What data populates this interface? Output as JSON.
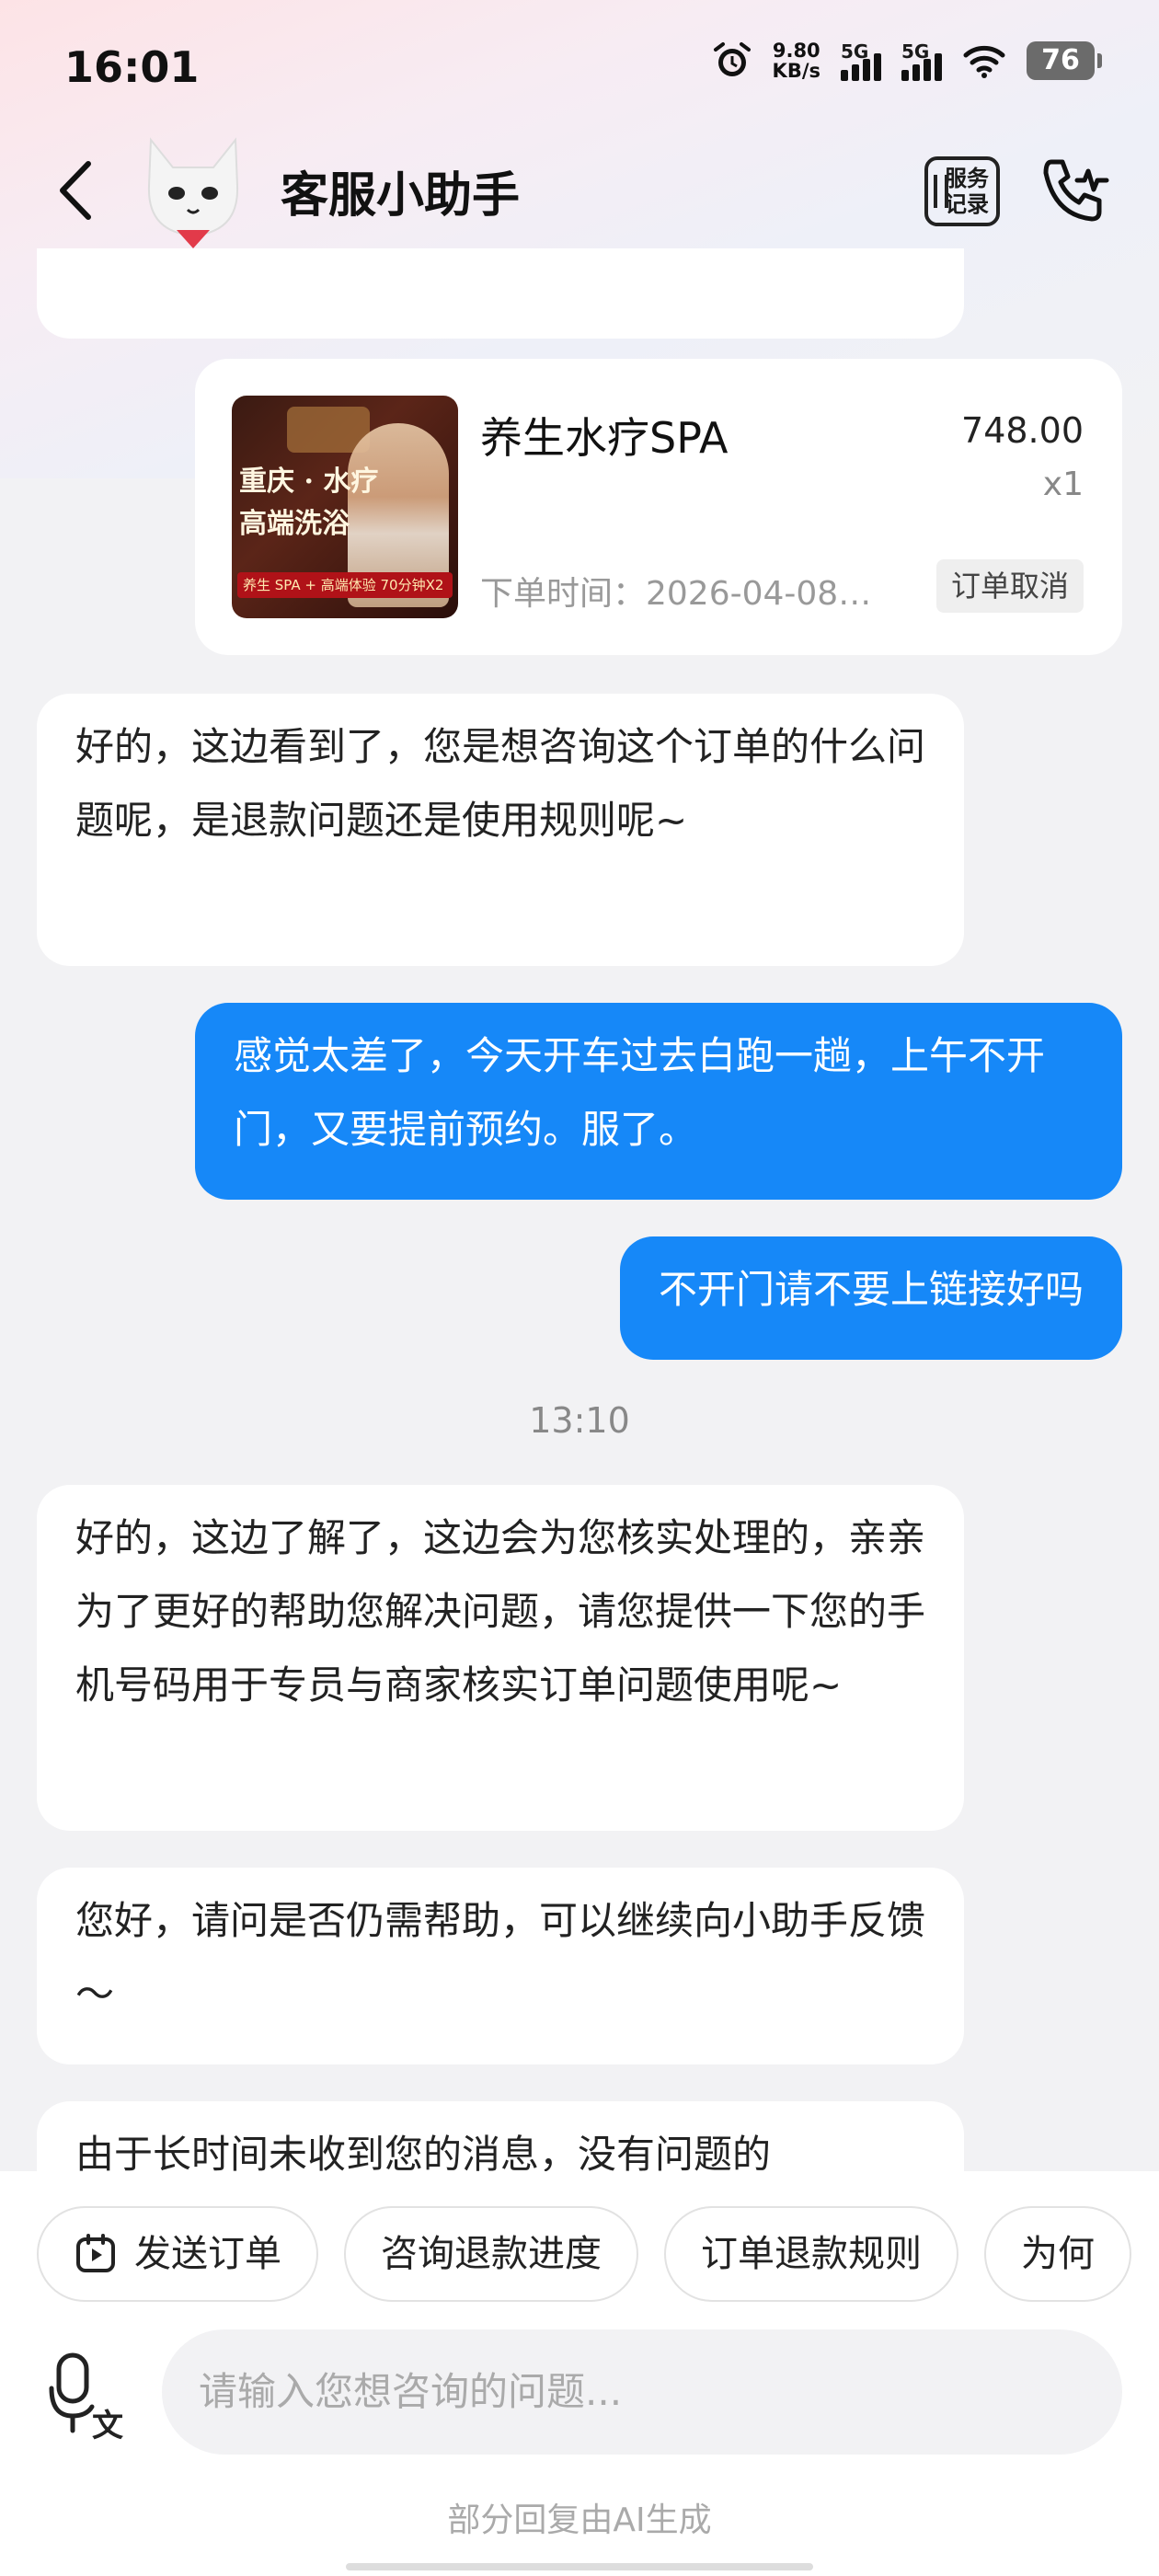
{
  "status_bar": {
    "time": "16:01",
    "speed_value": "9.80",
    "speed_unit": "KB/s",
    "signal1": "5G",
    "signal2": "5G",
    "battery": "76"
  },
  "header": {
    "title": "客服小助手",
    "service_record_line1": "服务",
    "service_record_line2": "记录"
  },
  "order": {
    "image_line1": "重庆 · 水疗",
    "image_line2": "高端洗浴",
    "image_tag": "养生 SPA + 高端体验  70分钟X2",
    "name": "养生水疗SPA",
    "price": "748.00",
    "quantity": "x1",
    "order_time": "下单时间：2026-04-08…",
    "status": "订单取消"
  },
  "messages": [
    {
      "dir": "in",
      "text": "好的，这边看到了，您是想咨询这个订单的什么问题呢，是退款问题还是使用规则呢~"
    },
    {
      "dir": "out",
      "text": "感觉太差了，今天开车过去白跑一趟，上午不开门，又要提前预约。服了。"
    },
    {
      "dir": "out",
      "text": "不开门请不要上链接好吗"
    },
    {
      "dir": "in",
      "text": "好的，这边了解了，这边会为您核实处理的，亲亲为了更好的帮助您解决问题，请您提供一下您的手机号码用于专员与商家核实订单问题使用呢~"
    },
    {
      "dir": "in",
      "text": "您好，请问是否仍需帮助，可以继续向小助手反馈～"
    },
    {
      "dir": "in",
      "text": "由于长时间未收到您的消息，没有问题的"
    }
  ],
  "timestamp": "13:10",
  "quick_actions": [
    "发送订单",
    "咨询退款进度",
    "订单退款规则",
    "为何"
  ],
  "input": {
    "placeholder": "请输入您想咨询的问题..."
  },
  "ai_note": "部分回复由AI生成",
  "colors": {
    "accent": "#1688f8",
    "bg": "#f2f2f4"
  }
}
